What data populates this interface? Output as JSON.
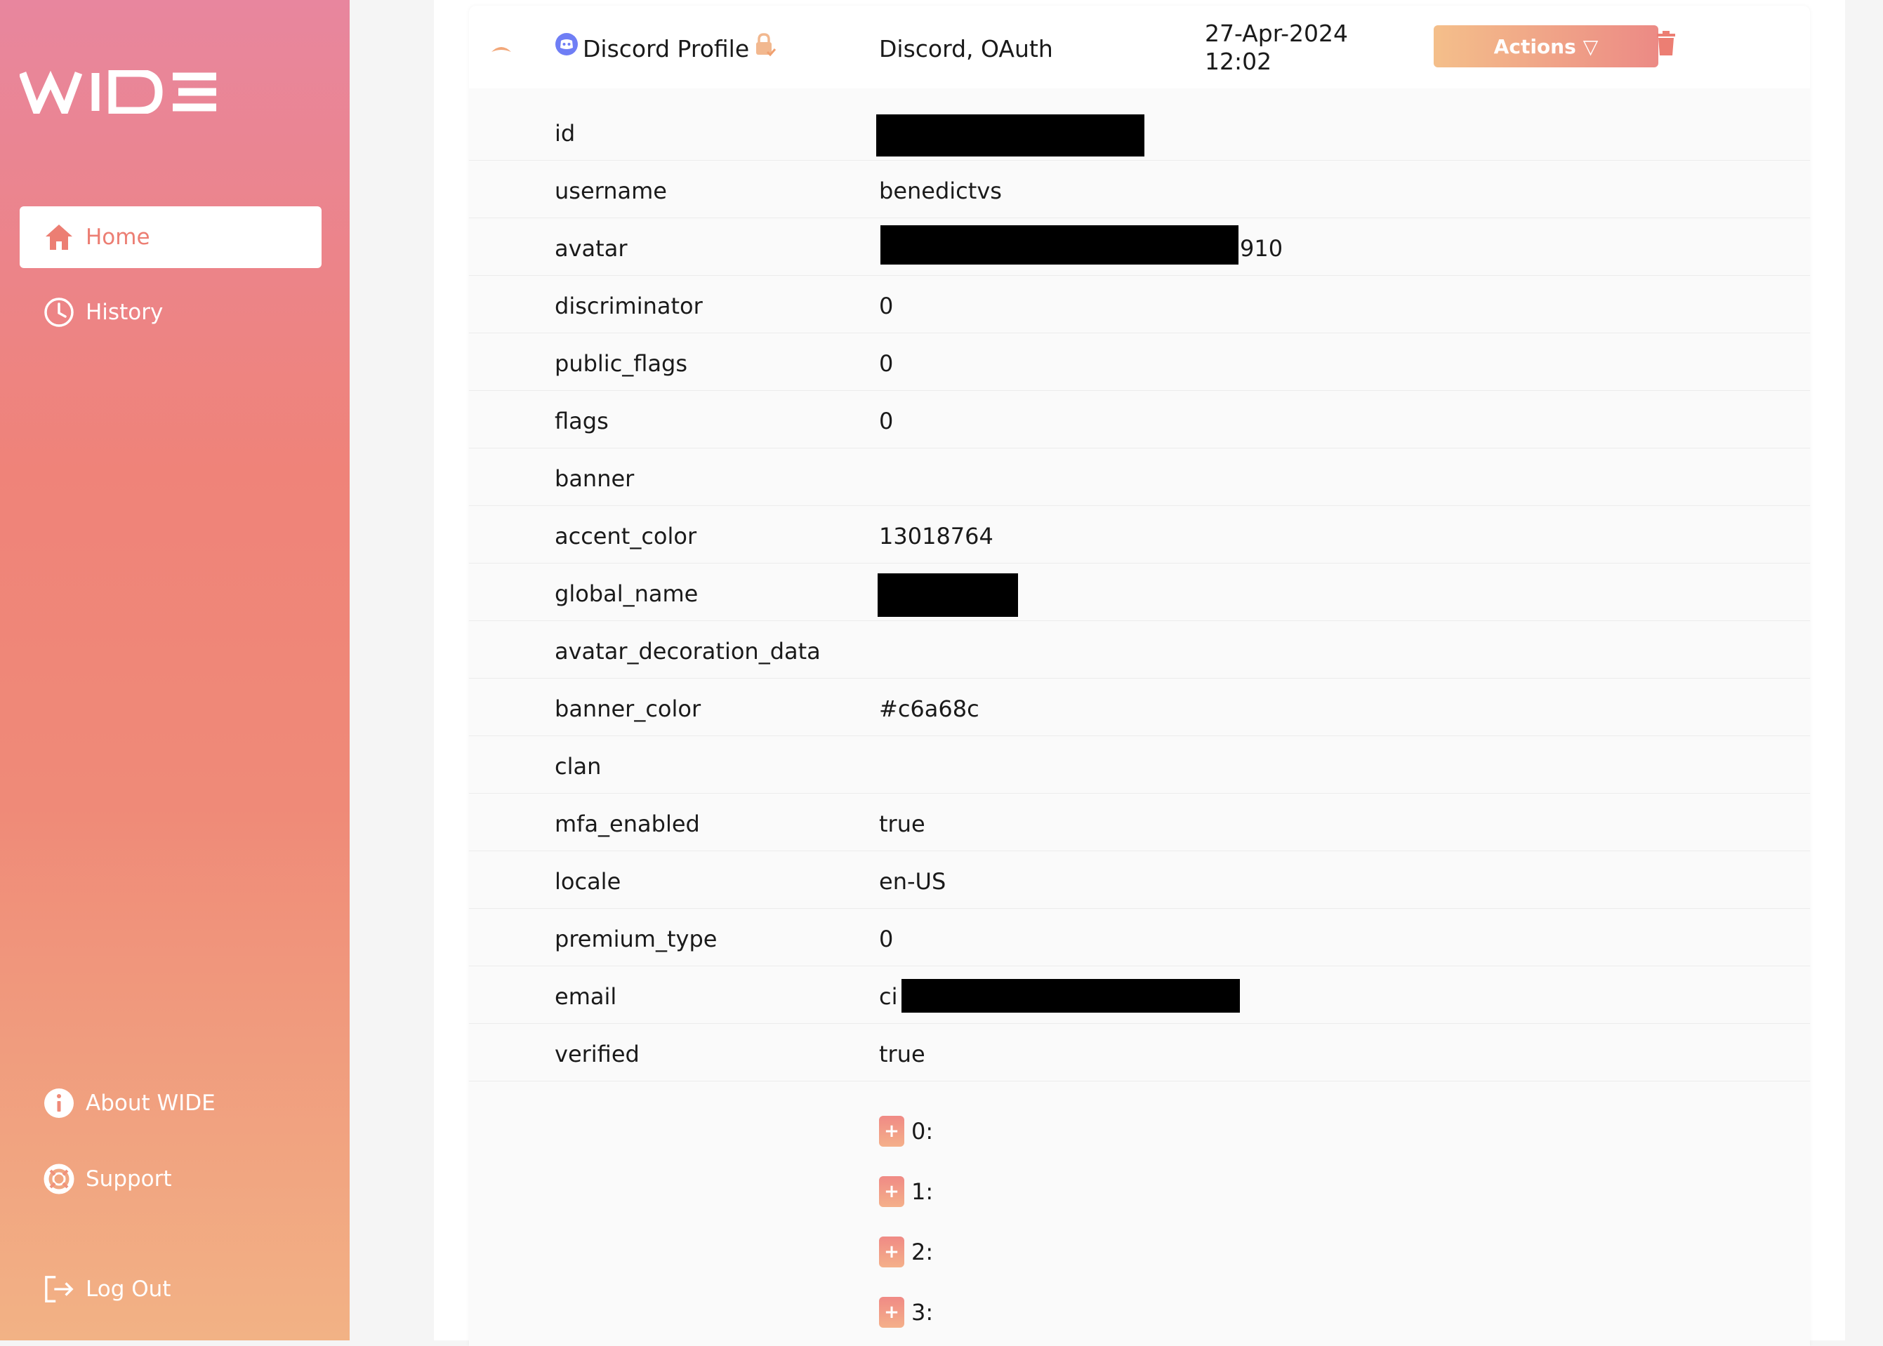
{
  "sidebar": {
    "logo_text": "WIDE",
    "items": [
      {
        "label": "Home"
      },
      {
        "label": "History"
      },
      {
        "label": "About WIDE"
      },
      {
        "label": "Support"
      },
      {
        "label": "Log Out"
      }
    ]
  },
  "record": {
    "title": "Discord Profile",
    "type": "Discord, OAuth",
    "date": "27-Apr-2024",
    "time": "12:02",
    "actions_label": "Actions",
    "actions_caret": "▽"
  },
  "fields": [
    {
      "key": "id",
      "value": ""
    },
    {
      "key": "username",
      "value": "benedictvs"
    },
    {
      "key": "avatar",
      "value": "910"
    },
    {
      "key": "discriminator",
      "value": "0"
    },
    {
      "key": "public_flags",
      "value": "0"
    },
    {
      "key": "flags",
      "value": "0"
    },
    {
      "key": "banner",
      "value": ""
    },
    {
      "key": "accent_color",
      "value": "13018764"
    },
    {
      "key": "global_name",
      "value": ""
    },
    {
      "key": "avatar_decoration_data",
      "value": ""
    },
    {
      "key": "banner_color",
      "value": "#c6a68c"
    },
    {
      "key": "clan",
      "value": ""
    },
    {
      "key": "mfa_enabled",
      "value": "true"
    },
    {
      "key": "locale",
      "value": "en-US"
    },
    {
      "key": "premium_type",
      "value": "0"
    },
    {
      "key": "email",
      "value": "ci"
    },
    {
      "key": "verified",
      "value": "true"
    }
  ],
  "list_items": [
    {
      "label": "0:"
    },
    {
      "label": "1:"
    },
    {
      "label": "2:"
    },
    {
      "label": "3:"
    }
  ],
  "colors": {
    "accent": "#ec7e73",
    "sidebar_top": "#e8869e",
    "sidebar_bottom": "#f2b285"
  }
}
